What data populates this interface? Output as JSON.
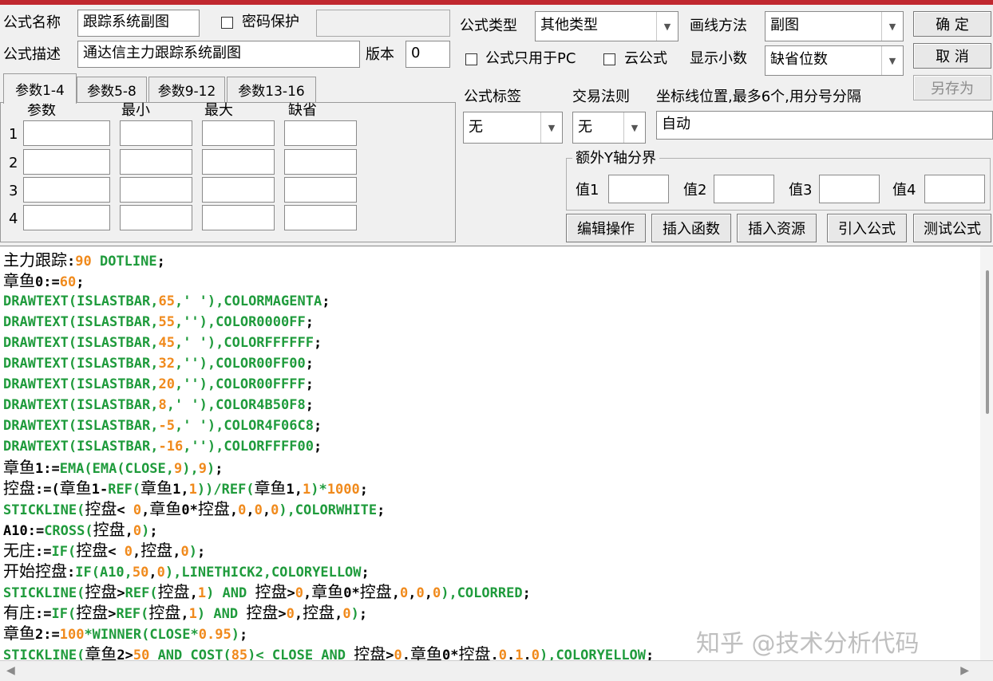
{
  "header": {
    "name_label": "公式名称",
    "name_value": "跟踪系统副图",
    "password_label": "密码保护",
    "password_value": "",
    "desc_label": "公式描述",
    "desc_value": "通达信主力跟踪系统副图",
    "version_label": "版本",
    "version_value": "0",
    "type_label": "公式类型",
    "type_value": "其他类型",
    "draw_label": "画线方法",
    "draw_value": "副图",
    "pc_only_label": "公式只用于PC",
    "cloud_label": "云公式",
    "decimals_label": "显示小数",
    "decimals_value": "缺省位数"
  },
  "buttons": {
    "ok": "确  定",
    "cancel": "取  消",
    "saveas": "另存为",
    "edit_ops": "编辑操作",
    "insert_func": "插入函数",
    "insert_res": "插入资源",
    "import_formula": "引入公式",
    "test_formula": "测试公式"
  },
  "tabs": [
    "参数1-4",
    "参数5-8",
    "参数9-12",
    "参数13-16"
  ],
  "params": {
    "col_headers": [
      "参数",
      "最小",
      "最大",
      "缺省"
    ],
    "rows": [
      "1",
      "2",
      "3",
      "4"
    ]
  },
  "right_panel": {
    "tag_label": "公式标签",
    "tag_value": "无",
    "rule_label": "交易法则",
    "rule_value": "无",
    "axis_label": "坐标线位置,最多6个,用分号分隔",
    "axis_value": "自动",
    "yaxis_group": "额外Y轴分界",
    "val_labels": [
      "值1",
      "值2",
      "值3",
      "值4"
    ]
  },
  "code_lines": [
    [
      [
        "cn",
        "主力跟踪"
      ],
      [
        "p",
        ":"
      ],
      [
        "n",
        "90"
      ],
      [
        "k",
        " DOTLINE"
      ],
      [
        "p",
        ";"
      ]
    ],
    [
      [
        "cn",
        "章鱼"
      ],
      [
        "p",
        "0:="
      ],
      [
        "n",
        "60"
      ],
      [
        "p",
        ";"
      ]
    ],
    [
      [
        "k",
        "DRAWTEXT(ISLASTBAR,"
      ],
      [
        "n",
        "65"
      ],
      [
        "k",
        ",' '),COLORMAGENTA"
      ],
      [
        "p",
        ";"
      ]
    ],
    [
      [
        "k",
        "DRAWTEXT(ISLASTBAR,"
      ],
      [
        "n",
        "55"
      ],
      [
        "k",
        ",''),COLOR0000FF"
      ],
      [
        "p",
        ";"
      ]
    ],
    [
      [
        "k",
        "DRAWTEXT(ISLASTBAR,"
      ],
      [
        "n",
        "45"
      ],
      [
        "k",
        ",' '),COLORFFFFFF"
      ],
      [
        "p",
        ";"
      ]
    ],
    [
      [
        "k",
        "DRAWTEXT(ISLASTBAR,"
      ],
      [
        "n",
        "32"
      ],
      [
        "k",
        ",''),COLOR00FF00"
      ],
      [
        "p",
        ";"
      ]
    ],
    [
      [
        "k",
        "DRAWTEXT(ISLASTBAR,"
      ],
      [
        "n",
        "20"
      ],
      [
        "k",
        ",''),COLOR00FFFF"
      ],
      [
        "p",
        ";"
      ]
    ],
    [
      [
        "k",
        "DRAWTEXT(ISLASTBAR,"
      ],
      [
        "n",
        "8"
      ],
      [
        "k",
        ",' '),COLOR4B50F8"
      ],
      [
        "p",
        ";"
      ]
    ],
    [
      [
        "k",
        "DRAWTEXT(ISLASTBAR,"
      ],
      [
        "n",
        "-5"
      ],
      [
        "k",
        ",' '),COLOR4F06C8"
      ],
      [
        "p",
        ";"
      ]
    ],
    [
      [
        "k",
        "DRAWTEXT(ISLASTBAR,"
      ],
      [
        "n",
        "-16"
      ],
      [
        "k",
        ",''),COLORFFFF00"
      ],
      [
        "p",
        ";"
      ]
    ],
    [
      [
        "cn",
        "章鱼"
      ],
      [
        "p",
        "1:="
      ],
      [
        "k",
        "EMA(EMA(CLOSE,"
      ],
      [
        "n",
        "9"
      ],
      [
        "k"
      ],
      [
        "k",
        "),"
      ],
      [
        "n",
        "9"
      ],
      [
        "k",
        ")"
      ],
      [
        "p",
        ";"
      ]
    ],
    [
      [
        "cn",
        "控盘"
      ],
      [
        "p",
        ":=("
      ],
      [
        "cn",
        "章鱼"
      ],
      [
        "p",
        "1-"
      ],
      [
        "k",
        "REF("
      ],
      [
        "cn",
        "章鱼"
      ],
      [
        "p",
        "1,"
      ],
      [
        "n",
        "1"
      ],
      [
        "k",
        "))/REF("
      ],
      [
        "cn",
        "章鱼"
      ],
      [
        "p",
        "1,"
      ],
      [
        "n",
        "1"
      ],
      [
        "k",
        ")*"
      ],
      [
        "n",
        "1000"
      ],
      [
        "p",
        ";"
      ]
    ],
    [
      [
        "k",
        "STICKLINE("
      ],
      [
        "cn",
        "控盘"
      ],
      [
        "p",
        "< "
      ],
      [
        "n",
        "0"
      ],
      [
        "p",
        ","
      ],
      [
        "cn",
        "章鱼"
      ],
      [
        "p",
        "0*"
      ],
      [
        "cn",
        "控盘"
      ],
      [
        "p",
        ","
      ],
      [
        "n",
        "0"
      ],
      [
        "p",
        ","
      ],
      [
        "n",
        "0"
      ],
      [
        "p",
        ","
      ],
      [
        "n",
        "0"
      ],
      [
        "k",
        "),COLORWHITE"
      ],
      [
        "p",
        ";"
      ]
    ],
    [
      [
        "p",
        "A10:="
      ],
      [
        "k",
        "CROSS("
      ],
      [
        "cn",
        "控盘"
      ],
      [
        "p",
        ","
      ],
      [
        "n",
        "0"
      ],
      [
        "k",
        ")"
      ],
      [
        "p",
        ";"
      ]
    ],
    [
      [
        "cn",
        "无庄"
      ],
      [
        "p",
        ":="
      ],
      [
        "k",
        "IF("
      ],
      [
        "cn",
        "控盘"
      ],
      [
        "p",
        "< "
      ],
      [
        "n",
        "0"
      ],
      [
        "p",
        ","
      ],
      [
        "cn",
        "控盘"
      ],
      [
        "p",
        ","
      ],
      [
        "n",
        "0"
      ],
      [
        "k",
        ")"
      ],
      [
        "p",
        ";"
      ]
    ],
    [
      [
        "cn",
        "开始控盘"
      ],
      [
        "p",
        ":"
      ],
      [
        "k",
        "IF(A10,"
      ],
      [
        "n",
        "50"
      ],
      [
        "p",
        ","
      ],
      [
        "n",
        "0"
      ],
      [
        "k",
        "),LINETHICK2,COLORYELLOW"
      ],
      [
        "p",
        ";"
      ]
    ],
    [
      [
        "k",
        "STICKLINE("
      ],
      [
        "cn",
        "控盘"
      ],
      [
        "p",
        ">"
      ],
      [
        "k",
        "REF("
      ],
      [
        "cn",
        "控盘"
      ],
      [
        "p",
        ","
      ],
      [
        "n",
        "1"
      ],
      [
        "k",
        ") AND "
      ],
      [
        "cn",
        "控盘"
      ],
      [
        "p",
        ">"
      ],
      [
        "n",
        "0"
      ],
      [
        "p",
        ","
      ],
      [
        "cn",
        "章鱼"
      ],
      [
        "p",
        "0*"
      ],
      [
        "cn",
        "控盘"
      ],
      [
        "p",
        ","
      ],
      [
        "n",
        "0"
      ],
      [
        "p",
        ","
      ],
      [
        "n",
        "0"
      ],
      [
        "p",
        ","
      ],
      [
        "n",
        "0"
      ],
      [
        "k",
        "),COLORRED"
      ],
      [
        "p",
        ";"
      ]
    ],
    [
      [
        "cn",
        "有庄"
      ],
      [
        "p",
        ":="
      ],
      [
        "k",
        "IF("
      ],
      [
        "cn",
        "控盘"
      ],
      [
        "p",
        ">"
      ],
      [
        "k",
        "REF("
      ],
      [
        "cn",
        "控盘"
      ],
      [
        "p",
        ","
      ],
      [
        "n",
        "1"
      ],
      [
        "k",
        ") AND "
      ],
      [
        "cn",
        "控盘"
      ],
      [
        "p",
        ">"
      ],
      [
        "n",
        "0"
      ],
      [
        "p",
        ","
      ],
      [
        "cn",
        "控盘"
      ],
      [
        "p",
        ","
      ],
      [
        "n",
        "0"
      ],
      [
        "k",
        ")"
      ],
      [
        "p",
        ";"
      ]
    ],
    [
      [
        "cn",
        "章鱼"
      ],
      [
        "p",
        "2:="
      ],
      [
        "n",
        "100"
      ],
      [
        "k",
        "*WINNER(CLOSE*"
      ],
      [
        "n",
        "0.95"
      ],
      [
        "k",
        ")"
      ],
      [
        "p",
        ";"
      ]
    ],
    [
      [
        "k",
        "STICKLINE("
      ],
      [
        "cn",
        "章鱼"
      ],
      [
        "p",
        "2>"
      ],
      [
        "n",
        "50"
      ],
      [
        "k",
        " AND COST("
      ],
      [
        "n",
        "85"
      ],
      [
        "k",
        ")< CLOSE AND "
      ],
      [
        "cn",
        "控盘"
      ],
      [
        "p",
        ">"
      ],
      [
        "n",
        "0"
      ],
      [
        "p",
        "."
      ],
      [
        "cn",
        "章鱼"
      ],
      [
        "p",
        "0*"
      ],
      [
        "cn",
        "控盘"
      ],
      [
        "p",
        "."
      ],
      [
        "n",
        "0"
      ],
      [
        "p",
        "."
      ],
      [
        "n",
        "1"
      ],
      [
        "p",
        "."
      ],
      [
        "n",
        "0"
      ],
      [
        "k",
        "),COLORYELLOW"
      ],
      [
        "p",
        ";"
      ]
    ]
  ],
  "watermark": "知乎 @技术分析代码",
  "colors": {
    "keyword": "#1f9b3c",
    "number": "#f08a1c",
    "title_bar": "#c0282f"
  }
}
